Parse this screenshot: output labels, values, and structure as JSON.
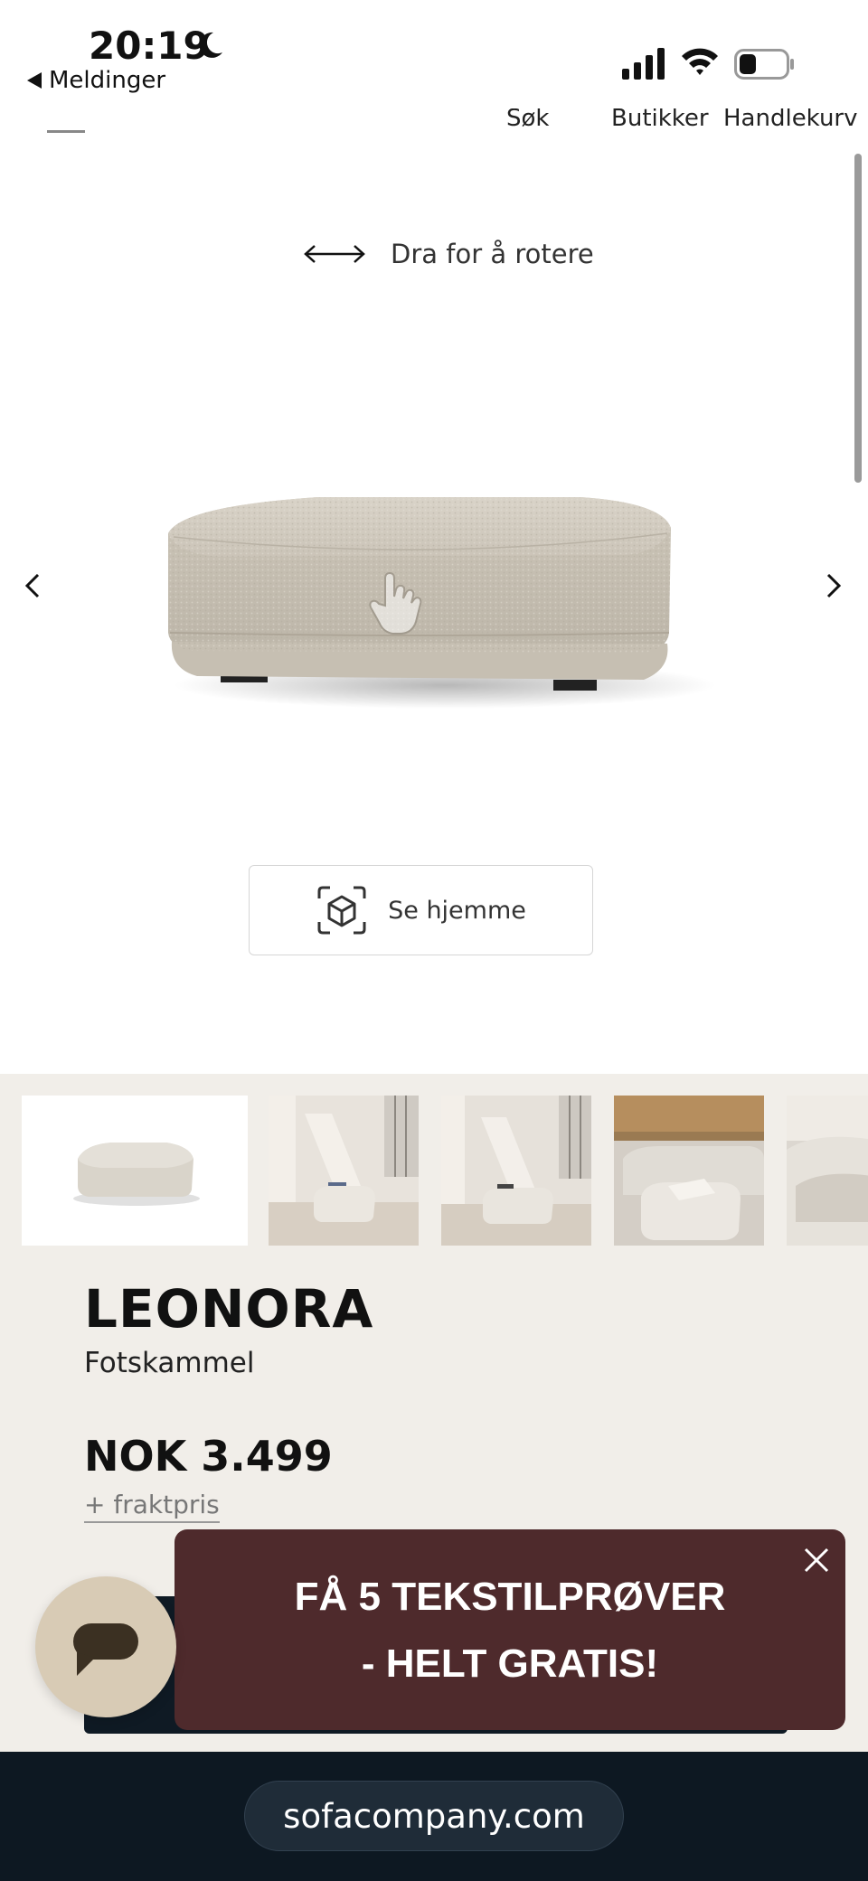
{
  "status_bar": {
    "time": "20:19",
    "back_app": "Meldinger"
  },
  "nav": {
    "search": "Søk",
    "stores": "Butikker",
    "cart": "Handlekurv"
  },
  "viewer": {
    "rotate_hint": "Dra for å rotere",
    "ar_button": "Se hjemme"
  },
  "product": {
    "name": "LEONORA",
    "type": "Fotskammel",
    "price": "NOK 3.499",
    "shipping": "+ fraktpris"
  },
  "promo": {
    "line1": "FÅ 5 TEKSTILPRØVER",
    "line2": "- HELT GRATIS!"
  },
  "browser": {
    "url": "sofacompany.com"
  },
  "colors": {
    "promo_bg": "#4e2a2c",
    "section_bg": "#f1eee9",
    "chat_bg": "#d8cbb5",
    "browser_bg": "#0d1822"
  }
}
